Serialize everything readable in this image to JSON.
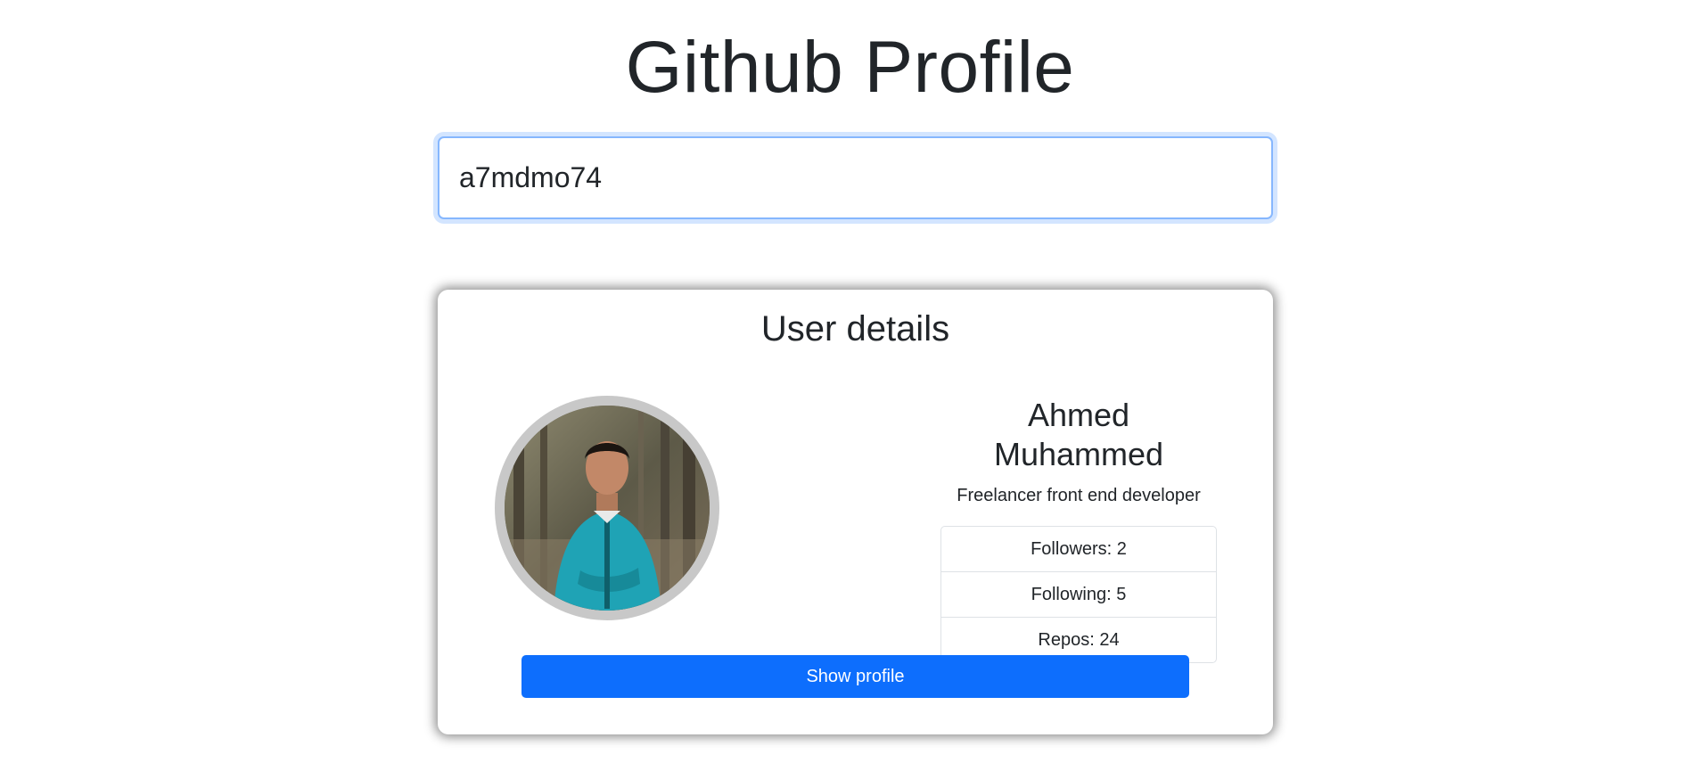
{
  "page": {
    "title": "Github Profile"
  },
  "search": {
    "value": "a7mdmo74"
  },
  "card": {
    "title": "User details",
    "avatar_icon": "user-avatar-photo",
    "name": "Ahmed Muhammed",
    "bio": "Freelancer front end developer",
    "stats": [
      {
        "label": "Followers: 2"
      },
      {
        "label": "Following: 5"
      },
      {
        "label": "Repos: 24"
      }
    ],
    "button_label": "Show profile"
  },
  "colors": {
    "accent": "#0d6efd",
    "focus_ring": "#86b7fe",
    "text": "#212529",
    "avatar_border": "#c8c8c8"
  }
}
